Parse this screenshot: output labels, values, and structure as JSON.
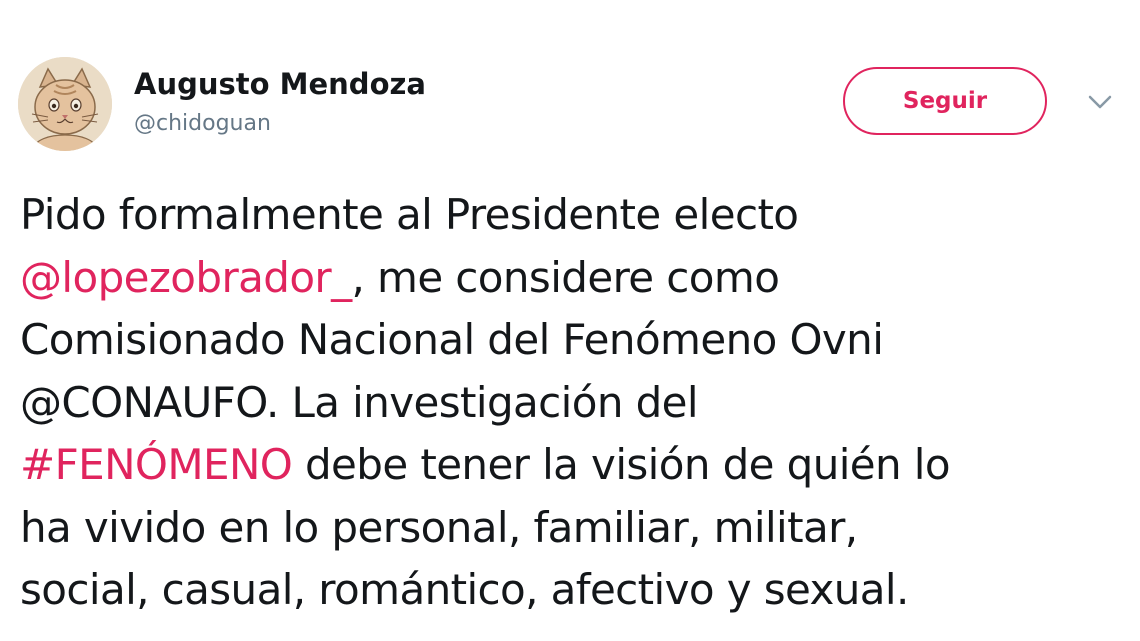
{
  "tweet": {
    "author": {
      "display_name": "Augusto Mendoza",
      "handle": "@chidoguan",
      "avatar_icon": "cat-avatar-icon"
    },
    "follow_label": "Seguir",
    "menu_icon": "chevron-down-icon",
    "colors": {
      "accent": "#e0245e",
      "text": "#14171a",
      "muted": "#657786"
    },
    "text": {
      "line1": "Pido formalmente al Presidente electo",
      "mention_lopez": "@lopezobrador_",
      "line2_rest": ", me considere como",
      "line3": "Comisionado Nacional del Fenómeno Ovni",
      "line4": "@CONAUFO. La investigación del",
      "hashtag": "#FENÓMENO",
      "line5_rest": " debe tener la visión de quién lo",
      "line6": "ha vivido en lo personal, familiar, militar,",
      "line7": "social, casual, romántico, afectivo y sexual."
    }
  }
}
